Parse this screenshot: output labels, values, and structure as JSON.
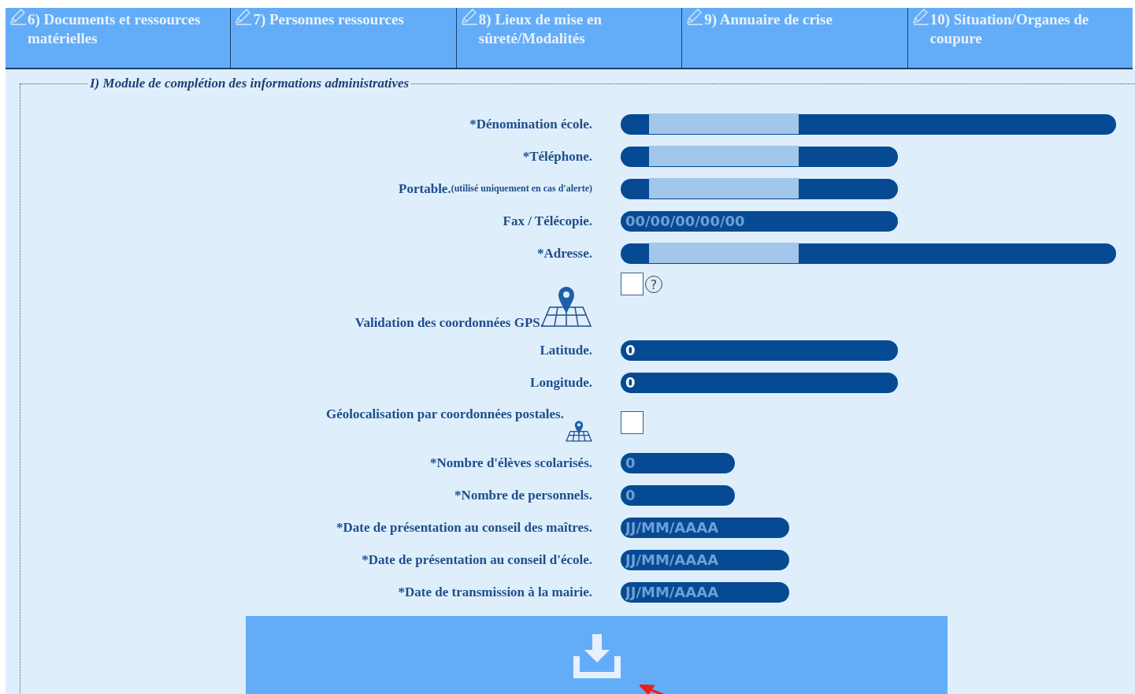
{
  "tabs": [
    {
      "label": "6) Documents et ressources matérielles",
      "selected": false
    },
    {
      "label": "7) Personnes ressources",
      "selected": false
    },
    {
      "label": "8) Lieux de mise en sûreté/Modalités",
      "selected": false
    },
    {
      "label": "9) Annuaire de crise",
      "selected": false
    },
    {
      "label": "10) Situation/Organes de coupure",
      "selected": false
    }
  ],
  "section": {
    "legend": "I) Module de complétion des informations administratives",
    "rows": [
      {
        "kind": "field",
        "label": "*Dénomination école.",
        "redacted": true
      },
      {
        "kind": "field",
        "label": "*Téléphone.",
        "redacted": true
      },
      {
        "kind": "field",
        "label": "Portable.",
        "note": "(utilisé uniquement en cas d'alerte)",
        "redacted": true
      },
      {
        "kind": "field",
        "label": "Fax / Télécopie.",
        "placeholder": "00/00/00/00/00"
      },
      {
        "kind": "field",
        "label": "*Adresse.",
        "redacted": true
      },
      {
        "kind": "gps",
        "label": "Validation des coordonnées GPS.",
        "checked": false,
        "help": "?"
      },
      {
        "kind": "field",
        "label": "Latitude.",
        "value": "0"
      },
      {
        "kind": "field",
        "label": "Longitude.",
        "value": "0"
      },
      {
        "kind": "geo",
        "label": "Géolocalisation par coordonnées postales.",
        "checked": false
      },
      {
        "kind": "field",
        "label": "*Nombre d'élèves scolarisés.",
        "placeholder": "0"
      },
      {
        "kind": "field",
        "label": "*Nombre de personnels.",
        "placeholder": "0"
      },
      {
        "kind": "field",
        "label": "*Date de présentation au conseil des maîtres.",
        "placeholder": "JJ/MM/AAAA"
      },
      {
        "kind": "field",
        "label": "*Date de présentation au conseil d'école.",
        "placeholder": "JJ/MM/AAAA"
      },
      {
        "kind": "field",
        "label": "*Date de transmission à la mairie.",
        "placeholder": "JJ/MM/AAAA"
      }
    ]
  }
}
